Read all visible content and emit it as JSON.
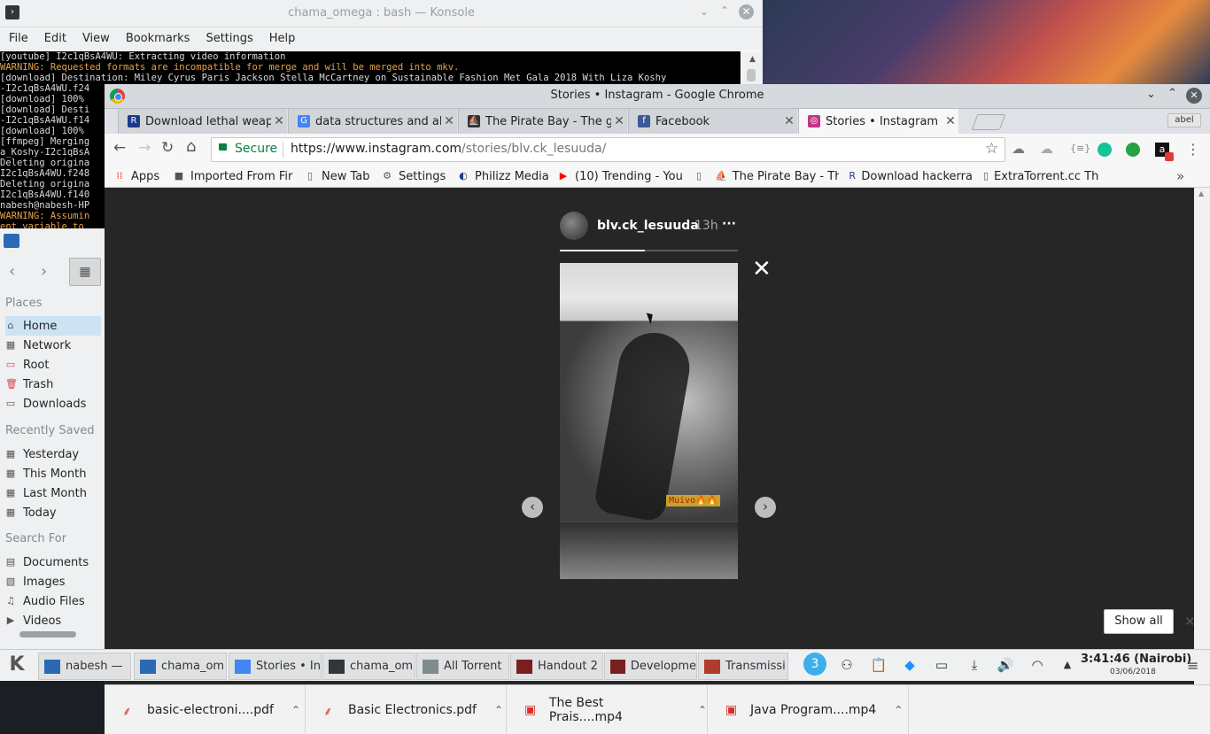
{
  "konsole": {
    "title": "chama_omega : bash — Konsole",
    "menu": [
      "File",
      "Edit",
      "View",
      "Bookmarks",
      "Settings",
      "Help"
    ],
    "lines": [
      {
        "text": "[youtube] I2c1qBsA4WU: Extracting video information",
        "warn": false
      },
      {
        "text": "WARNING: Requested formats are incompatible for merge and will be merged into mkv.",
        "warn": true
      },
      {
        "text": "[download] Destination: Miley Cyrus Paris Jackson Stella McCartney on Sustainable Fashion Met Gala 2018 With Liza Koshy",
        "warn": false
      },
      {
        "text": "-I2c1qBsA4WU.f24",
        "warn": false
      },
      {
        "text": "[download] 100%",
        "warn": false
      },
      {
        "text": "[download] Desti",
        "warn": false
      },
      {
        "text": "-I2c1qBsA4WU.f14",
        "warn": false
      },
      {
        "text": "[download] 100%",
        "warn": false
      },
      {
        "text": "[ffmpeg] Merging",
        "warn": false
      },
      {
        "text": "a_Koshy-I2c1qBsA",
        "warn": false
      },
      {
        "text": "Deleting origina",
        "warn": false
      },
      {
        "text": "I2c1qBsA4WU.f248",
        "warn": false
      },
      {
        "text": "Deleting origina",
        "warn": false
      },
      {
        "text": "I2c1qBsA4WU.f140",
        "warn": false
      },
      {
        "text": "nabesh@nabesh-HP",
        "warn": false
      },
      {
        "text": "WARNING: Assumin",
        "warn": true
      },
      {
        "text": "ent variable to",
        "warn": true
      }
    ]
  },
  "dolphin": {
    "places_header": "Places",
    "places": [
      {
        "label": "Home",
        "icon": "home-icon",
        "glyph": "⌂",
        "selected": true
      },
      {
        "label": "Network",
        "icon": "network-icon",
        "glyph": "▦",
        "selected": false
      },
      {
        "label": "Root",
        "icon": "root-folder-icon",
        "glyph": "▭",
        "selected": false
      },
      {
        "label": "Trash",
        "icon": "trash-icon",
        "glyph": "🗑",
        "selected": false
      },
      {
        "label": "Downloads",
        "icon": "downloads-folder-icon",
        "glyph": "▭",
        "selected": false
      }
    ],
    "recent_header": "Recently Saved",
    "recent": [
      {
        "label": "Yesterday",
        "icon": "calendar-icon"
      },
      {
        "label": "This Month",
        "icon": "calendar-icon"
      },
      {
        "label": "Last Month",
        "icon": "calendar-icon"
      },
      {
        "label": "Today",
        "icon": "calendar-icon"
      }
    ],
    "search_header": "Search For",
    "search": [
      {
        "label": "Documents",
        "icon": "documents-icon"
      },
      {
        "label": "Images",
        "icon": "images-icon"
      },
      {
        "label": "Audio Files",
        "icon": "audio-icon"
      },
      {
        "label": "Videos",
        "icon": "videos-icon"
      }
    ]
  },
  "chrome": {
    "window_title": "Stories • Instagram - Google Chrome",
    "profile": "abel",
    "tabs": [
      {
        "title": "Download lethal weap",
        "favicon": "R",
        "color": "#1a3a8a",
        "active": false
      },
      {
        "title": "data structures and al",
        "favicon": "G",
        "color": "#4285f4",
        "active": false
      },
      {
        "title": "The Pirate Bay - The g",
        "favicon": "⛵",
        "color": "#333333",
        "active": false
      },
      {
        "title": "Facebook",
        "favicon": "f",
        "color": "#3b5998",
        "active": false
      },
      {
        "title": "Stories • Instagram",
        "favicon": "◎",
        "color": "#c13584",
        "active": true
      }
    ],
    "secure_label": "Secure",
    "url_host": "https://www.instagram.com",
    "url_path": "/stories/blv.ck_lesuuda/",
    "bookmarks": [
      {
        "label": "Apps",
        "icon": "apps-icon"
      },
      {
        "label": "Imported From Fir",
        "icon": "folder-icon"
      },
      {
        "label": "New Tab",
        "icon": "page-icon"
      },
      {
        "label": "Settings",
        "icon": "gear-icon"
      },
      {
        "label": "Philizz Media",
        "icon": "philizz-icon"
      },
      {
        "label": "(10) Trending - You",
        "icon": "youtube-icon"
      },
      {
        "label": "",
        "icon": "page-icon"
      },
      {
        "label": "The Pirate Bay - The",
        "icon": "pirate-icon"
      },
      {
        "label": "Download hackerra",
        "icon": "r-icon"
      },
      {
        "label": "ExtraTorrent.cc The",
        "icon": "page-icon"
      }
    ],
    "story": {
      "username": "blv.ck_lesuuda",
      "age": "13h",
      "more": "···",
      "sticker": "Muivo🔥🔥",
      "progress": 0.48
    },
    "downloads": [
      {
        "name": "basic-electroni....pdf",
        "icon": "pdf-icon"
      },
      {
        "name": "Basic Electronics.pdf",
        "icon": "pdf-icon"
      },
      {
        "name": "The Best Prais....mp4",
        "icon": "video-file-icon"
      },
      {
        "name": "Java Program....mp4",
        "icon": "video-file-icon"
      }
    ],
    "show_all": "Show all"
  },
  "taskbar": {
    "tasks": [
      {
        "label": "nabesh —",
        "icon": "dolphin-icon",
        "color": "#2a6ab5"
      },
      {
        "label": "chama_om",
        "icon": "dolphin-icon",
        "color": "#2a6ab5"
      },
      {
        "label": "Stories • In",
        "icon": "chrome-icon",
        "color": "#4285f4"
      },
      {
        "label": "chama_om",
        "icon": "konsole-icon",
        "color": "#31363b"
      },
      {
        "label": "All Torrent",
        "icon": "download-icon",
        "color": "#7f8c8d"
      },
      {
        "label": "Handout 2",
        "icon": "okular-icon",
        "color": "#7a1f1f"
      },
      {
        "label": "Developme",
        "icon": "okular-icon",
        "color": "#7a1f1f"
      },
      {
        "label": "Transmissi",
        "icon": "transmission-icon",
        "color": "#b03a2e"
      }
    ],
    "workspace": "3",
    "clock_time": "3:41:46 (Nairobi)",
    "clock_date": "03/06/2018"
  }
}
